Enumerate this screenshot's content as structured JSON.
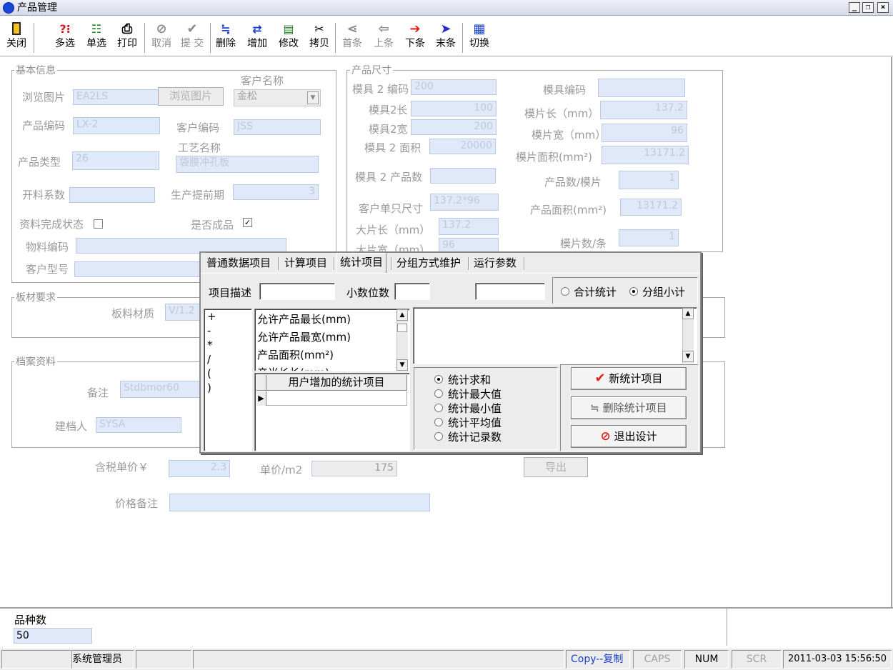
{
  "window": {
    "title": "产品管理",
    "min_label": "_",
    "restore_label": "❐",
    "close_label": "×"
  },
  "toolbar": {
    "close": {
      "label": "关闭",
      "icon": "door-exit-icon"
    },
    "multi": {
      "label": "多选",
      "icon": "multi-select-icon"
    },
    "single": {
      "label": "单选",
      "icon": "single-select-icon"
    },
    "print": {
      "label": "打印",
      "icon": "printer-icon"
    },
    "cancel": {
      "label": "取消",
      "icon": "cancel-icon"
    },
    "submit": {
      "label": "提 交",
      "icon": "check-icon"
    },
    "delete": {
      "label": "删除",
      "icon": "delete-row-icon"
    },
    "add": {
      "label": "增加",
      "icon": "add-row-icon"
    },
    "edit": {
      "label": "修改",
      "icon": "edit-doc-icon"
    },
    "copy": {
      "label": "拷贝",
      "icon": "copy-icon"
    },
    "first": {
      "label": "首条",
      "icon": "first-record-icon"
    },
    "prev": {
      "label": "上条",
      "icon": "previous-record-icon"
    },
    "next": {
      "label": "下条",
      "icon": "next-record-icon"
    },
    "last": {
      "label": "末条",
      "icon": "last-record-icon"
    },
    "switch": {
      "label": "切换",
      "icon": "grid-switch-icon"
    }
  },
  "basic": {
    "group_title": "基本信息",
    "browse_image_label": "浏览图片",
    "browse_image_value": "EA2LS",
    "browse_button": "浏览图片",
    "customer_name_label": "客户名称",
    "customer_name_value": "金松",
    "product_code_label": "产品编码",
    "product_code_value": "LX-2",
    "customer_code_label": "客户编码",
    "customer_code_value": "JSS",
    "product_type_label": "产品类型",
    "product_type_value": "26",
    "process_name_label": "工艺名称",
    "process_name_value": "袋膜冲孔板",
    "cutting_factor_label": "开料系数",
    "cutting_factor_value": "",
    "lead_time_label": "生产提前期",
    "lead_time_value": "3",
    "data_complete_label": "资料完成状态",
    "data_complete_checked": "",
    "is_finished_label": "是否成品",
    "is_finished_checked": "✓",
    "material_code_label": "物料编码",
    "material_code_value": "",
    "customer_model_label": "客户型号",
    "customer_model_value": ""
  },
  "size": {
    "group_title": "产品尺寸",
    "mold2_code_label": "模具 2 编码",
    "mold2_code_value": "200",
    "mold_code_label": "模具编码",
    "mold_code_value": "",
    "mold2_length_label": "模具2长",
    "mold2_length_value": "100",
    "sheet_length_label": "模片长（mm）",
    "sheet_length_value": "137.2",
    "mold2_width_label": "模具2宽",
    "mold2_width_value": "200",
    "sheet_width_label": "模片宽（mm）",
    "sheet_width_value": "96",
    "mold2_area_label": "模具 2 面积",
    "mold2_area_value": "20000",
    "sheet_area_label": "模片面积(mm²)",
    "sheet_area_value": "13171.2",
    "mold2_products_label": "模具 2 产品数",
    "mold2_products_value": "",
    "products_per_sheet_label": "产品数/模片",
    "products_per_sheet_value": "1",
    "customer_unit_size_label": "客户单只尺寸",
    "customer_unit_size_value": "137.2*96",
    "product_area_label": "产品面积(mm²)",
    "product_area_value": "13171.2",
    "big_length_label": "大片长（mm）",
    "big_length_value": "137.2",
    "big_width_label": "大片宽（mm）",
    "big_width_value": "96",
    "sheets_per_strip_label": "模片数/条",
    "sheets_per_strip_value": "1"
  },
  "board": {
    "group_title": "板材要求",
    "material_label": "板料材质",
    "material_value": "V/1.2"
  },
  "archive": {
    "group_title": "档案资料",
    "remark_label": "备注",
    "remark_value": "Stdbmor60",
    "creator_label": "建档人",
    "creator_value": "SYSA"
  },
  "price": {
    "tax_price_label": "含税单价￥",
    "tax_price_value": "2.3",
    "unit_price_label": "单价/m2",
    "unit_price_value": "175",
    "export_button": "导出",
    "price_remark_label": "价格备注",
    "price_remark_value": ""
  },
  "dialog": {
    "tabs": [
      "普通数据项目",
      "计算项目",
      "统计项目",
      "分组方式维护",
      "运行参数"
    ],
    "item_desc_label": "项目描述",
    "item_desc_value": "",
    "decimals_label": "小数位数",
    "decimals_value": "",
    "extra_value": "",
    "total_stat_label": "合计统计",
    "group_subtotal_label": "分组小计",
    "operators": [
      "+",
      "-",
      "*",
      "/",
      "(",
      ")"
    ],
    "fields": [
      "允许产品最长(mm)",
      "允许产品最宽(mm)",
      "产品面积(mm²)",
      "产当长长(mm)"
    ],
    "user_stats_header": "用户增加的统计项目",
    "expression_value": "",
    "stat_options": [
      "统计求和",
      "统计最大值",
      "统计最小值",
      "统计平均值",
      "统计记录数"
    ],
    "new_stat_button": "新统计项目",
    "delete_stat_button": "删除统计项目",
    "exit_design_button": "退出设计"
  },
  "bottom": {
    "variety_count_label": "品种数",
    "variety_count_value": "50"
  },
  "status": {
    "user": "系统管理员",
    "copy": "Copy--复制",
    "caps": "CAPS",
    "num": "NUM",
    "scr": "SCR",
    "datetime": "2011-03-03 15:56:50"
  },
  "colors": {
    "field_bg": "#dfe9fa",
    "disabled_text": "#9a9a9a",
    "copy_text": "#1a3fc8",
    "accent_red": "#e02020"
  }
}
